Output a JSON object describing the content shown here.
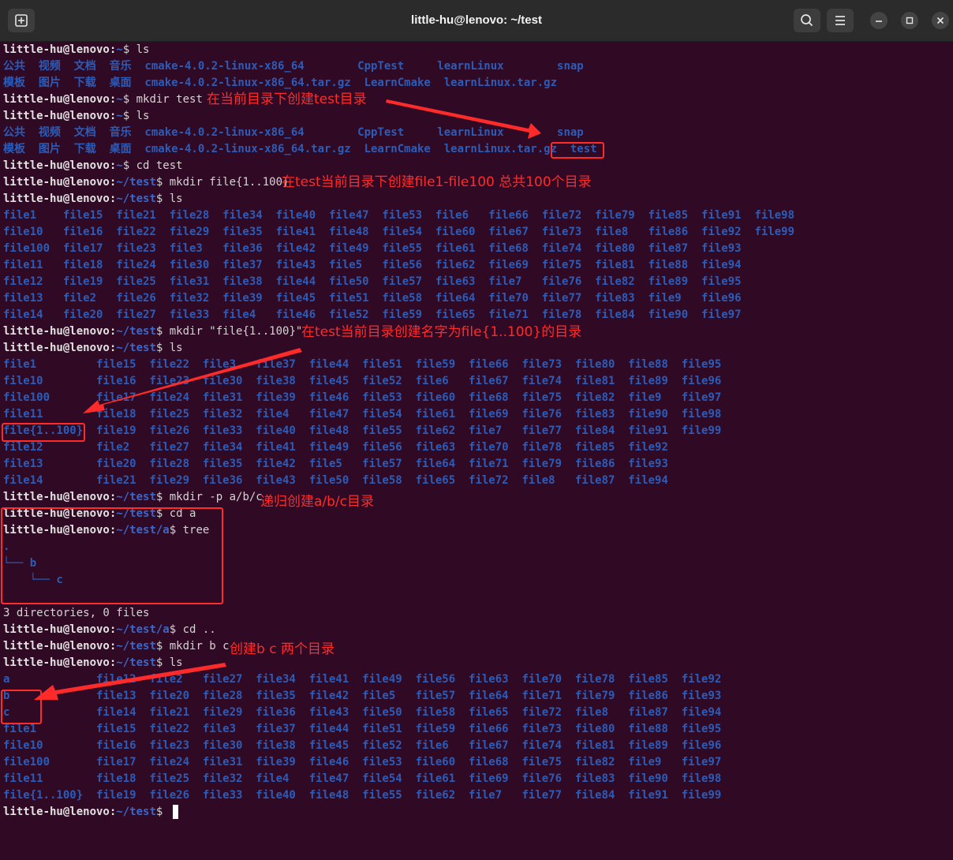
{
  "window": {
    "title": "little-hu@lenovo: ~/test"
  },
  "terminal": {
    "lines": [
      {
        "type": "cmd",
        "user": "little-hu@lenovo",
        "path": "~",
        "cmd": "ls"
      },
      {
        "type": "out",
        "text": "公共  视频  文档  音乐  cmake-4.0.2-linux-x86_64        CppTest     learnLinux        snap"
      },
      {
        "type": "out",
        "text": "模板  图片  下载  桌面  cmake-4.0.2-linux-x86_64.tar.gz  LearnCmake  learnLinux.tar.gz"
      },
      {
        "type": "cmd",
        "user": "little-hu@lenovo",
        "path": "~",
        "cmd": "mkdir test"
      },
      {
        "type": "cmd",
        "user": "little-hu@lenovo",
        "path": "~",
        "cmd": "ls"
      },
      {
        "type": "out",
        "text": "公共  视频  文档  音乐  cmake-4.0.2-linux-x86_64        CppTest     learnLinux        snap"
      },
      {
        "type": "out",
        "text": "模板  图片  下载  桌面  cmake-4.0.2-linux-x86_64.tar.gz  LearnCmake  learnLinux.tar.gz  test"
      },
      {
        "type": "cmd",
        "user": "little-hu@lenovo",
        "path": "~",
        "cmd": "cd test"
      },
      {
        "type": "cmd",
        "user": "little-hu@lenovo",
        "path": "~/test",
        "cmd": "mkdir file{1..100}"
      },
      {
        "type": "cmd",
        "user": "little-hu@lenovo",
        "path": "~/test",
        "cmd": "ls"
      },
      {
        "type": "out",
        "text": "file1    file15  file21  file28  file34  file40  file47  file53  file6   file66  file72  file79  file85  file91  file98"
      },
      {
        "type": "out",
        "text": "file10   file16  file22  file29  file35  file41  file48  file54  file60  file67  file73  file8   file86  file92  file99"
      },
      {
        "type": "out",
        "text": "file100  file17  file23  file3   file36  file42  file49  file55  file61  file68  file74  file80  file87  file93"
      },
      {
        "type": "out",
        "text": "file11   file18  file24  file30  file37  file43  file5   file56  file62  file69  file75  file81  file88  file94"
      },
      {
        "type": "out",
        "text": "file12   file19  file25  file31  file38  file44  file50  file57  file63  file7   file76  file82  file89  file95"
      },
      {
        "type": "out",
        "text": "file13   file2   file26  file32  file39  file45  file51  file58  file64  file70  file77  file83  file9   file96"
      },
      {
        "type": "out",
        "text": "file14   file20  file27  file33  file4   file46  file52  file59  file65  file71  file78  file84  file90  file97"
      },
      {
        "type": "cmd",
        "user": "little-hu@lenovo",
        "path": "~/test",
        "cmd": "mkdir \"file{1..100}\""
      },
      {
        "type": "cmd",
        "user": "little-hu@lenovo",
        "path": "~/test",
        "cmd": "ls"
      },
      {
        "type": "out",
        "text": "file1         file15  file22  file3   file37  file44  file51  file59  file66  file73  file80  file88  file95"
      },
      {
        "type": "out",
        "text": "file10        file16  file23  file30  file38  file45  file52  file6   file67  file74  file81  file89  file96"
      },
      {
        "type": "out",
        "text": "file100       file17  file24  file31  file39  file46  file53  file60  file68  file75  file82  file9   file97"
      },
      {
        "type": "out",
        "text": "file11        file18  file25  file32  file4   file47  file54  file61  file69  file76  file83  file90  file98"
      },
      {
        "type": "out",
        "text": "file{1..100}  file19  file26  file33  file40  file48  file55  file62  file7   file77  file84  file91  file99"
      },
      {
        "type": "out",
        "text": "file12        file2   file27  file34  file41  file49  file56  file63  file70  file78  file85  file92"
      },
      {
        "type": "out",
        "text": "file13        file20  file28  file35  file42  file5   file57  file64  file71  file79  file86  file93"
      },
      {
        "type": "out",
        "text": "file14        file21  file29  file36  file43  file50  file58  file65  file72  file8   file87  file94"
      },
      {
        "type": "cmd",
        "user": "little-hu@lenovo",
        "path": "~/test",
        "cmd": "mkdir -p a/b/c"
      },
      {
        "type": "cmd",
        "user": "little-hu@lenovo",
        "path": "~/test",
        "cmd": "cd a"
      },
      {
        "type": "cmd",
        "user": "little-hu@lenovo",
        "path": "~/test/a",
        "cmd": "tree"
      },
      {
        "type": "out",
        "text": "."
      },
      {
        "type": "out",
        "text": "└── b"
      },
      {
        "type": "out",
        "text": "    └── c"
      },
      {
        "type": "plain",
        "text": ""
      },
      {
        "type": "plain",
        "text": "3 directories, 0 files"
      },
      {
        "type": "cmd",
        "user": "little-hu@lenovo",
        "path": "~/test/a",
        "cmd": "cd .."
      },
      {
        "type": "cmd",
        "user": "little-hu@lenovo",
        "path": "~/test",
        "cmd": "mkdir b c"
      },
      {
        "type": "cmd",
        "user": "little-hu@lenovo",
        "path": "~/test",
        "cmd": "ls"
      },
      {
        "type": "out",
        "text": "a             file12  file2   file27  file34  file41  file49  file56  file63  file70  file78  file85  file92"
      },
      {
        "type": "out",
        "text": "b             file13  file20  file28  file35  file42  file5   file57  file64  file71  file79  file86  file93"
      },
      {
        "type": "out",
        "text": "c             file14  file21  file29  file36  file43  file50  file58  file65  file72  file8   file87  file94"
      },
      {
        "type": "out",
        "text": "file1         file15  file22  file3   file37  file44  file51  file59  file66  file73  file80  file88  file95"
      },
      {
        "type": "out",
        "text": "file10        file16  file23  file30  file38  file45  file52  file6   file67  file74  file81  file89  file96"
      },
      {
        "type": "out",
        "text": "file100       file17  file24  file31  file39  file46  file53  file60  file68  file75  file82  file9   file97"
      },
      {
        "type": "out",
        "text": "file11        file18  file25  file32  file4   file47  file54  file61  file69  file76  file83  file90  file98"
      },
      {
        "type": "out",
        "text": "file{1..100}  file19  file26  file33  file40  file48  file55  file62  file7   file77  file84  file91  file99"
      },
      {
        "type": "cmd",
        "user": "little-hu@lenovo",
        "path": "~/test",
        "cmd": ""
      }
    ],
    "annotations": [
      {
        "text": "在当前目录下创建test目录"
      },
      {
        "text": "在test当前目录下创建file1-file100 总共100个目录"
      },
      {
        "text": "在test当前目录创建名字为file{1..100}的目录"
      },
      {
        "text": "递归创建a/b/c目录"
      },
      {
        "text": "创建b c 两个目录"
      }
    ]
  },
  "colors": {
    "background": "#300a24",
    "directory": "#2c5cb8",
    "path": "#3a67c9",
    "annotation": "#ff2b2b"
  },
  "icons": [
    "new-tab-icon",
    "search-icon",
    "menu-icon",
    "minimize-icon",
    "maximize-icon",
    "close-icon"
  ]
}
